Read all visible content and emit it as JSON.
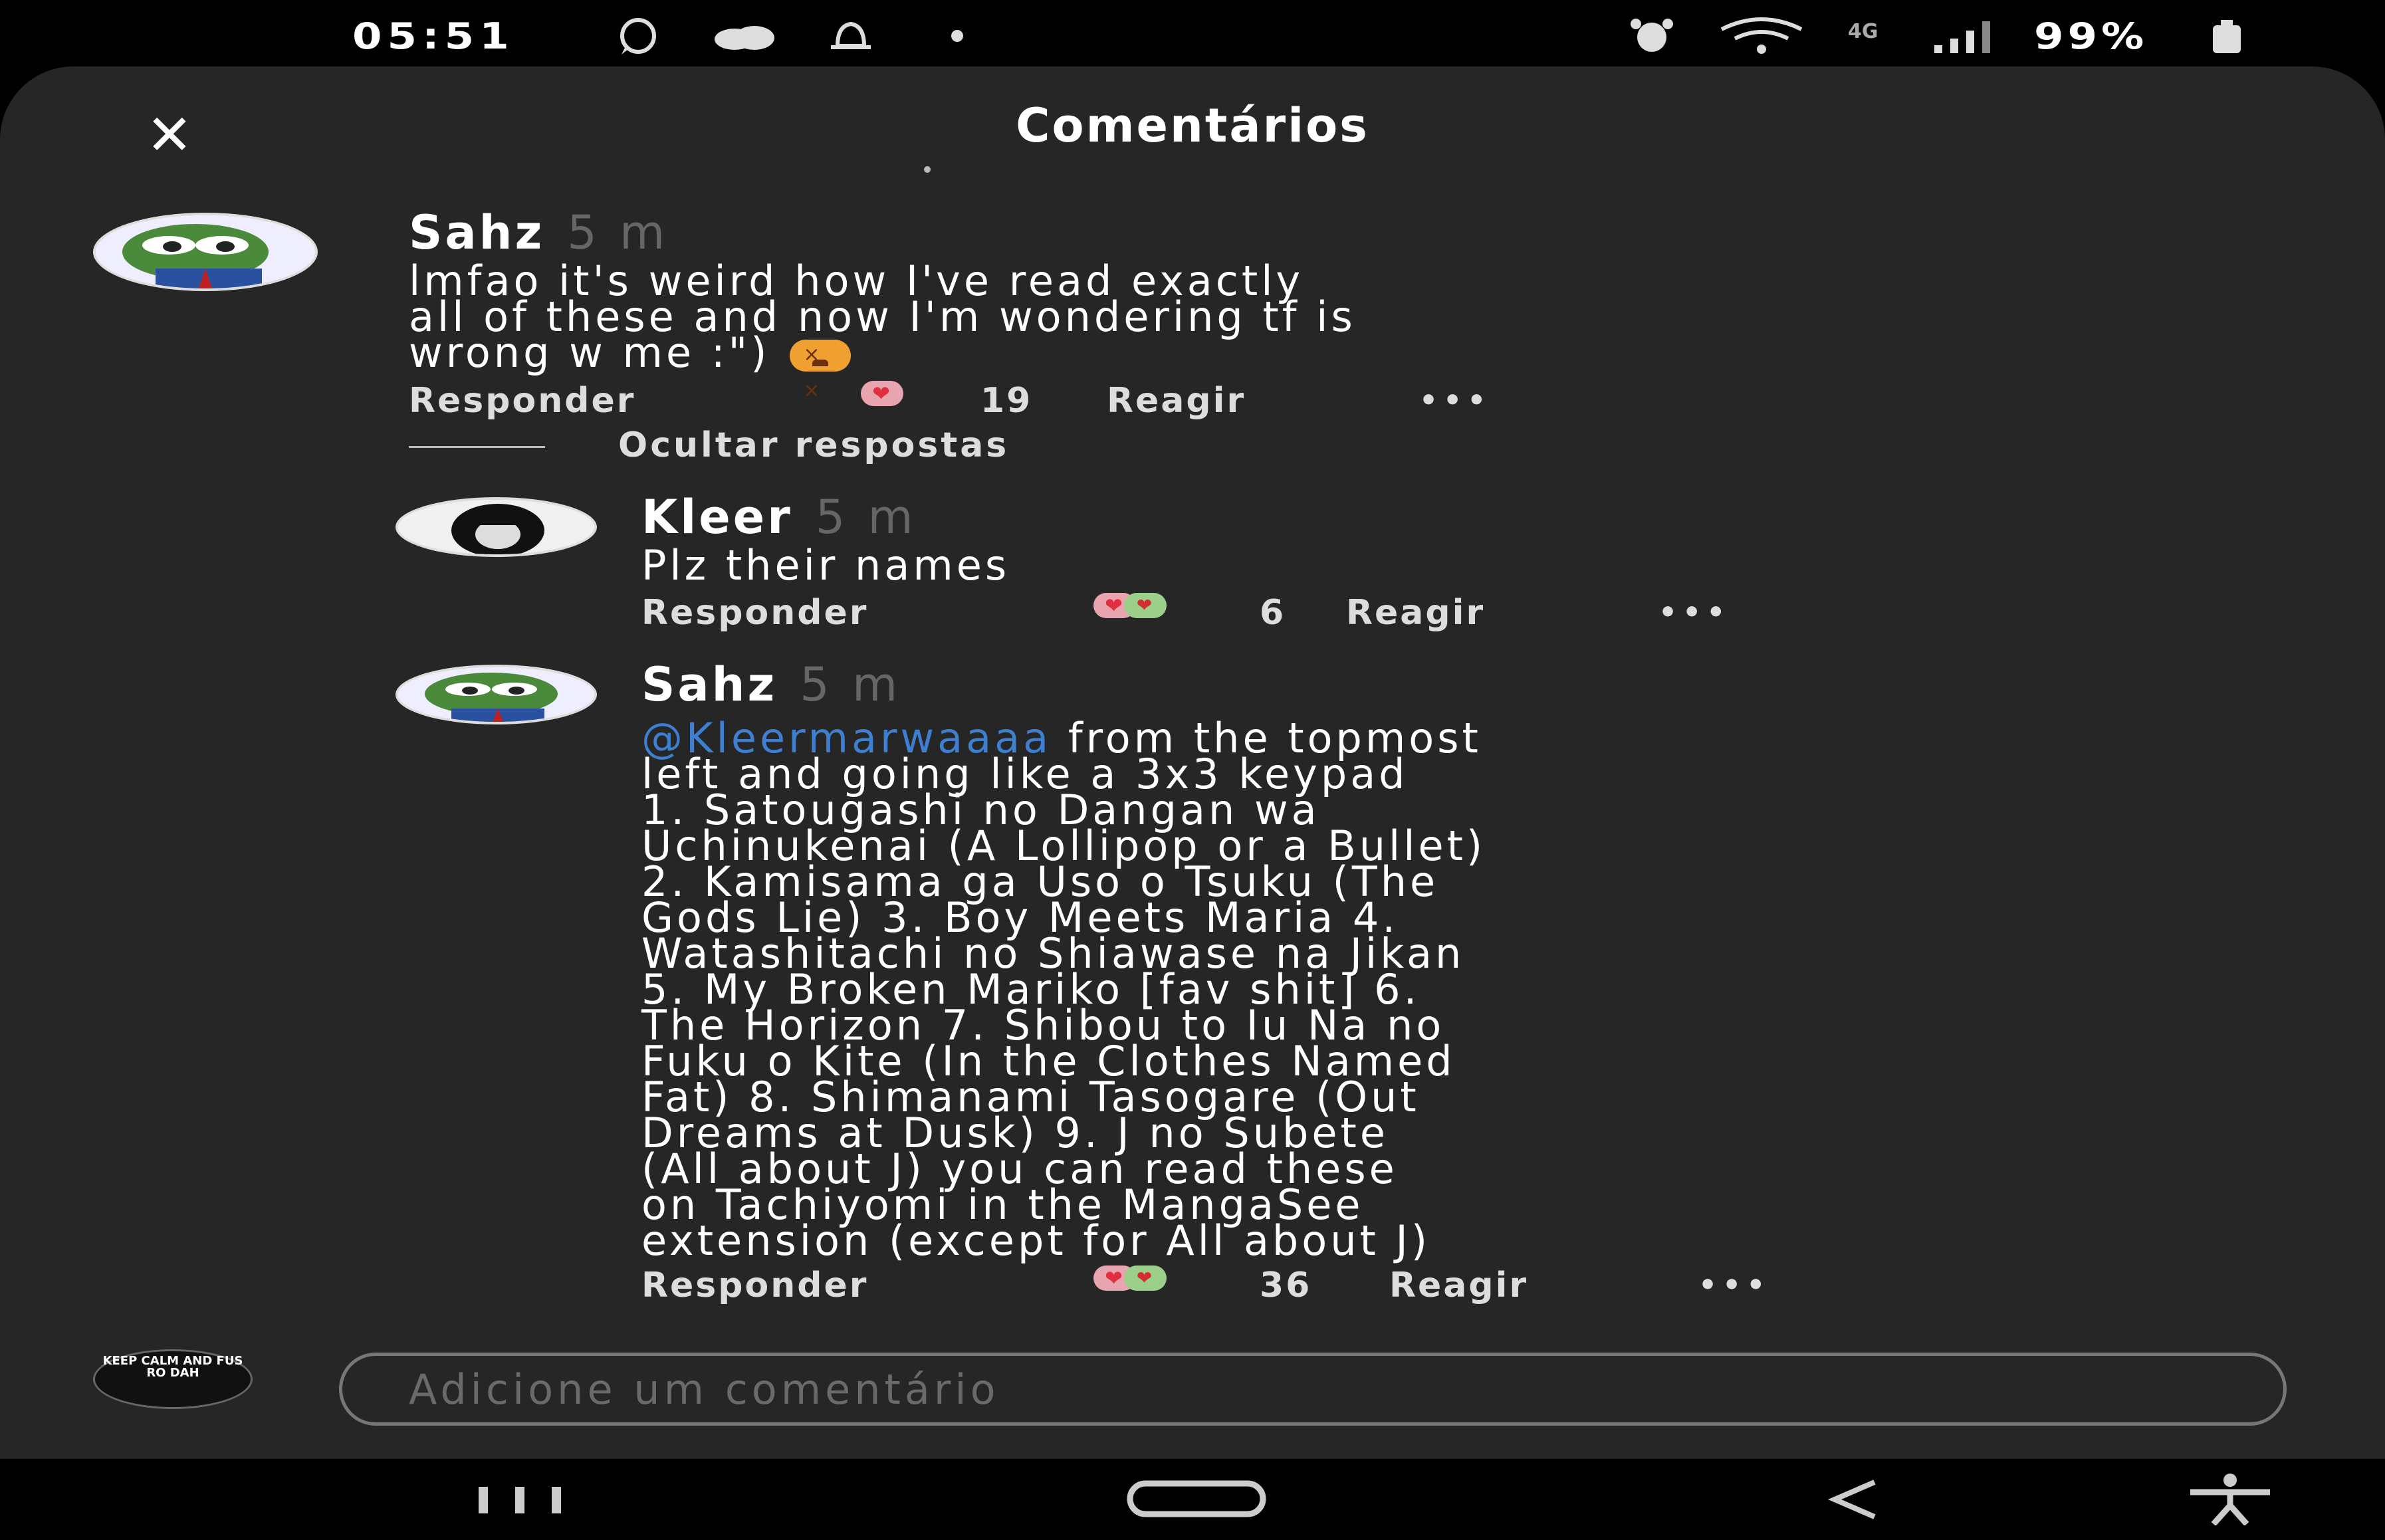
{
  "status_bar": {
    "time": "05:51",
    "network": "4G",
    "battery": "99%",
    "icons": [
      "whatsapp-icon",
      "cloud-icon",
      "bell-icon",
      "dot-icon",
      "alarm-icon",
      "wifi-icon",
      "signal-icon",
      "battery-icon"
    ]
  },
  "header": {
    "title": "Comentários",
    "close_icon": "close-icon"
  },
  "comments": [
    {
      "author": "Sahz",
      "time": "5 m",
      "text": "lmfao it's weird how I've read exactly\nall of these and now I'm wondering tf is\nwrong w me :\")",
      "emoji": "tired-face-emoji",
      "reply_label": "Responder",
      "reaction_count": "19",
      "react_label": "Reagir",
      "more": "•••",
      "hide_replies": "Ocultar respostas"
    },
    {
      "author": "Kleer",
      "time": "5 m",
      "text": "Plz their names",
      "reply_label": "Responder",
      "reaction_count": "6",
      "react_label": "Reagir",
      "more": "•••"
    },
    {
      "author": "Sahz",
      "time": "5 m",
      "mention": "@Kleermarwaaaa",
      "text_after_mention": " from the topmost",
      "text": "left and going like a 3x3 keypad\n1. Satougashi no Dangan wa\nUchinukenai (A Lollipop or a Bullet)\n2. Kamisama ga Uso o Tsuku (The\nGods Lie) 3. Boy Meets Maria 4.\nWatashitachi no Shiawase na Jikan\n5. My Broken Mariko [fav shit] 6.\nThe Horizon 7. Shibou to Iu Na no\nFuku o Kite (In the Clothes Named\nFat) 8. Shimanami Tasogare (Out\nDreams at Dusk) 9. J no Subete\n(All about J) you can read these\non Tachiyomi in the MangaSee\nextension (except for All about J)",
      "reply_label": "Responder",
      "reaction_count": "36",
      "react_label": "Reagir",
      "more": "•••"
    }
  ],
  "input": {
    "placeholder": "Adicione um comentário",
    "avatar_text": "KEEP CALM AND FUS RO DAH"
  },
  "nav_bar": {
    "icons": [
      "recent-apps-icon",
      "home-icon",
      "back-icon",
      "accessibility-icon"
    ]
  },
  "colors": {
    "panel": "#262626",
    "mention": "#3f7fd0",
    "timestamp": "#666666"
  }
}
